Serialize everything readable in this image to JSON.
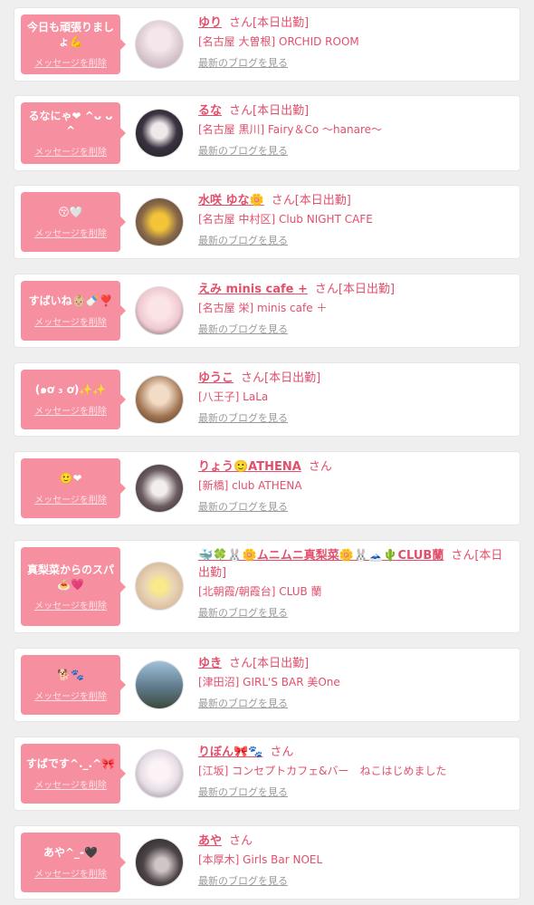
{
  "delete_label": "メッセージを削除",
  "blog_label": "最新のブログを見る",
  "san_label": "さん",
  "cards": [
    {
      "message": "今日も頑張りましょ💪",
      "name": "ゆり",
      "status": "[本日出勤]",
      "shop": "[名古屋 大曽根] ORCHID ROOM",
      "avatar_color": "#d8c7cf"
    },
    {
      "message": "るなにゃ❤︎ ^ᴗ ᴗ^",
      "name": "るな",
      "status": "[本日出勤]",
      "shop": "[名古屋 黒川] Fairy＆Co 〜hanare〜",
      "avatar_color": "#3a3340"
    },
    {
      "message": "😚🤍",
      "name": "水咲 ゆな🌼",
      "status": "[本日出勤]",
      "shop": "[名古屋 中村区] Club NIGHT CAFE",
      "avatar_color": "#6a5441"
    },
    {
      "message": "すばいね👶🏼🍼❣️",
      "name": "えみ minis cafe +",
      "status": "[本日出勤]",
      "shop": "[名古屋 栄] minis cafe ＋",
      "avatar_color": "#efc8d0"
    },
    {
      "message": "(๑ơ ₃ ơ)✨✨",
      "name": "ゆうこ",
      "status": "[本日出勤]",
      "shop": "[八王子] LaLa",
      "avatar_color": "#a07451"
    },
    {
      "message": "🙂❤",
      "name": "りょう🙂ATHENA",
      "status": "",
      "shop": "[新橋] club ATHENA",
      "avatar_color": "#3b3033"
    },
    {
      "message": "真梨菜からのスパ🍝💗",
      "name": "🐳🍀🐰🌼ムニムニ真梨菜🌼🐰🗻🌵CLUB蘭",
      "status": "[本日出勤]",
      "shop": "[北朝霞/朝霞台] CLUB 蘭",
      "avatar_color": "#e8d3b8"
    },
    {
      "message": "🐕🐾",
      "name": "ゆき",
      "status": "[本日出勤]",
      "shop": "[津田沼] GIRL'S BAR 美One",
      "avatar_color": "#5f7a8c"
    },
    {
      "message": "すばです^._.^🎀",
      "name": "りぼん🎀🐾",
      "status": "",
      "shop": "[江坂] コンセプトカフェ&バー　ねこはじめました",
      "avatar_color": "#e6dde6"
    },
    {
      "message": "あや^_-🖤",
      "name": "あや",
      "status": "",
      "shop": "[本厚木] Girls Bar NOEL",
      "avatar_color": "#2f2b2e"
    }
  ]
}
